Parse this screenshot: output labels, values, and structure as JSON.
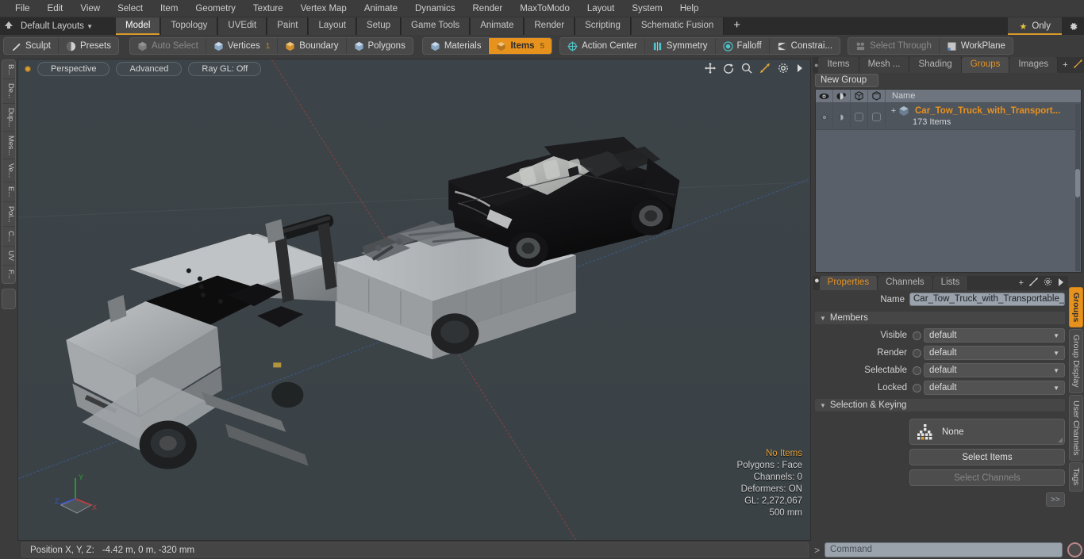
{
  "app": {
    "name": "Modo",
    "accent": "#e8921e",
    "viewport_bg": "#3b4347"
  },
  "menubar": {
    "items": [
      {
        "label": "File"
      },
      {
        "label": "Edit"
      },
      {
        "label": "View"
      },
      {
        "label": "Select"
      },
      {
        "label": "Item"
      },
      {
        "label": "Geometry"
      },
      {
        "label": "Texture"
      },
      {
        "label": "Vertex Map"
      },
      {
        "label": "Animate"
      },
      {
        "label": "Dynamics"
      },
      {
        "label": "Render"
      },
      {
        "label": "MaxToModo"
      },
      {
        "label": "Layout"
      },
      {
        "label": "System"
      },
      {
        "label": "Help"
      }
    ]
  },
  "layoutbar": {
    "home_icon": "home-icon",
    "layout_selector": "Default Layouts",
    "tabs": [
      {
        "label": "Model",
        "active": true
      },
      {
        "label": "Topology",
        "active": false
      },
      {
        "label": "UVEdit",
        "active": false
      },
      {
        "label": "Paint",
        "active": false
      },
      {
        "label": "Layout",
        "active": false
      },
      {
        "label": "Setup",
        "active": false
      },
      {
        "label": "Game Tools",
        "active": false
      },
      {
        "label": "Animate",
        "active": false
      },
      {
        "label": "Render",
        "active": false
      },
      {
        "label": "Scripting",
        "active": false
      },
      {
        "label": "Schematic Fusion",
        "active": false
      }
    ],
    "add_tab": "+",
    "only_label": "Only",
    "gear_icon": "gear-icon"
  },
  "modebar": {
    "group1": [
      {
        "label": "Sculpt",
        "icon": "pen-icon",
        "state": "normal"
      },
      {
        "label": "Presets",
        "icon": "sphere-icon",
        "state": "normal"
      }
    ],
    "group2": [
      {
        "label": "Auto Select",
        "icon": "cube-gray-icon",
        "state": "disabled",
        "count": ""
      },
      {
        "label": "Vertices",
        "icon": "cube-blue-icon",
        "state": "normal",
        "count": "1"
      },
      {
        "label": "Boundary",
        "icon": "cube-orange-icon",
        "state": "normal",
        "count": ""
      },
      {
        "label": "Polygons",
        "icon": "cube-blue-icon",
        "state": "normal",
        "count": ""
      }
    ],
    "group3": [
      {
        "label": "Materials",
        "icon": "cube-blue-icon",
        "state": "normal",
        "count": ""
      },
      {
        "label": "Items",
        "icon": "cube-orange-icon",
        "state": "active",
        "count": "5"
      }
    ],
    "group4": [
      {
        "label": "Action Center",
        "icon": "target-icon",
        "state": "normal"
      },
      {
        "label": "Symmetry",
        "icon": "symmetry-icon",
        "state": "normal"
      },
      {
        "label": "Falloff",
        "icon": "falloff-icon",
        "state": "normal"
      },
      {
        "label": "Constrai...",
        "icon": "constraint-icon",
        "state": "normal"
      }
    ],
    "group5": [
      {
        "label": "Select Through",
        "icon": "select-through-icon",
        "state": "disabled"
      },
      {
        "label": "WorkPlane",
        "icon": "workplane-icon",
        "state": "normal"
      }
    ]
  },
  "left_toolbar": {
    "items": [
      {
        "label": "B..."
      },
      {
        "label": "De..."
      },
      {
        "label": "Dup..."
      },
      {
        "label": "Mes..."
      },
      {
        "label": "Ve..."
      },
      {
        "label": "E..."
      },
      {
        "label": "Pol..."
      },
      {
        "label": "C..."
      },
      {
        "label": "UV"
      },
      {
        "label": "F..."
      }
    ]
  },
  "viewport": {
    "indicator_dot": "active-view-dot",
    "pills": [
      {
        "label": "Perspective",
        "name": "view-mode-selector"
      },
      {
        "label": "Advanced",
        "name": "shading-mode-selector"
      },
      {
        "label": "Ray GL: Off",
        "name": "raygl-toggle"
      }
    ],
    "icons": [
      {
        "name": "move-icon",
        "glyph": "✛"
      },
      {
        "name": "rotate-icon",
        "glyph": "↻"
      },
      {
        "name": "zoom-icon",
        "glyph": "⌕"
      },
      {
        "name": "fit-icon",
        "glyph": "⤡"
      },
      {
        "name": "settings-icon",
        "glyph": "⚙"
      },
      {
        "name": "more-icon",
        "glyph": "▶"
      }
    ],
    "stats": {
      "selection": "No Items",
      "polygons": "Polygons : Face",
      "channels": "Channels: 0",
      "deformers": "Deformers: ON",
      "gl": "GL: 2,272,067",
      "gridsize": "500 mm"
    },
    "axis_gizmo": {
      "x": "X",
      "y": "Y",
      "z": "Z"
    },
    "scene_description": "3D perspective view of a grey tow truck with a black sedan car loaded on its transportable flatbed"
  },
  "right_panel": {
    "tabs": [
      {
        "label": "Items",
        "active": false
      },
      {
        "label": "Mesh ...",
        "active": false
      },
      {
        "label": "Shading",
        "active": false
      },
      {
        "label": "Groups",
        "active": true
      },
      {
        "label": "Images",
        "active": false
      }
    ],
    "add_tab": "+",
    "new_group_button": "New Group",
    "tree": {
      "columns": [
        {
          "name": "visible-eye-column",
          "icon": "eye-icon"
        },
        {
          "name": "render-column",
          "icon": "render-icon"
        },
        {
          "name": "selectable-column",
          "icon": "cube-outline-icon"
        },
        {
          "name": "lock-column",
          "icon": "cube-wire-icon"
        },
        {
          "name": "name-column",
          "label": "Name"
        }
      ],
      "rows": [
        {
          "name": "Car_Tow_Truck_with_Transport...",
          "subtitle": "173 Items",
          "expander": "+",
          "icon": "group-cube-icon"
        }
      ]
    }
  },
  "properties": {
    "tabs": [
      {
        "label": "Properties",
        "active": true
      },
      {
        "label": "Channels",
        "active": false
      },
      {
        "label": "Lists",
        "active": false
      }
    ],
    "add_tab": "+",
    "name_label": "Name",
    "name_value": "Car_Tow_Truck_with_Transportable_C",
    "sections": [
      {
        "title": "Members"
      },
      {
        "title": "Selection & Keying"
      }
    ],
    "fields": [
      {
        "label": "Visible",
        "value": "default"
      },
      {
        "label": "Render",
        "value": "default"
      },
      {
        "label": "Selectable",
        "value": "default"
      },
      {
        "label": "Locked",
        "value": "default"
      }
    ],
    "selection_keying": {
      "none_label": "None",
      "none_icon": "items-grid-icon",
      "select_items": "Select Items",
      "select_channels": "Select Channels",
      "expand_button": ">>"
    },
    "vertical_tabs": [
      {
        "label": "Groups",
        "active": true
      },
      {
        "label": "Group Display",
        "active": false
      },
      {
        "label": "User Channels",
        "active": false
      },
      {
        "label": "Tags",
        "active": false
      }
    ]
  },
  "statusbar": {
    "position_label": "Position X, Y, Z:",
    "position_value": "-4.42 m, 0 m, -320 mm",
    "command_prompt": ">",
    "command_placeholder": "Command",
    "record_icon": "record-icon"
  }
}
